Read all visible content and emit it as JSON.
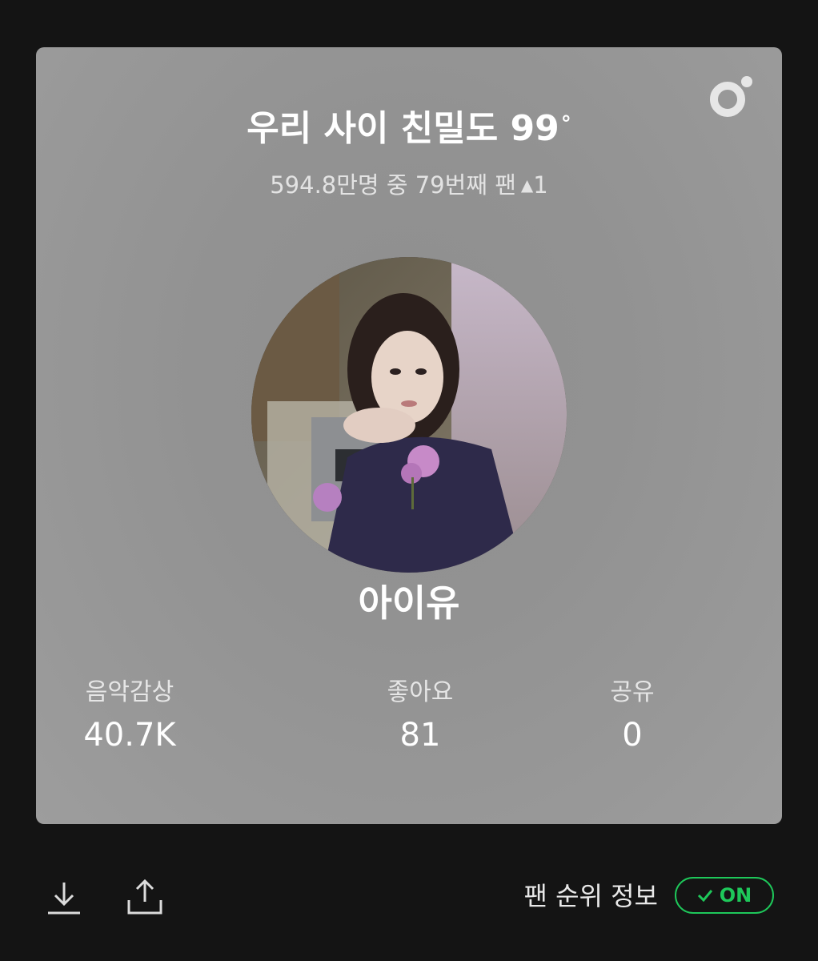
{
  "card": {
    "title": "우리 사이 친밀도 99",
    "title_degree": "°",
    "subtitle": "594.8만명 중 79번째 팬",
    "rank_change_arrow": "▲",
    "rank_change_value": "1",
    "logo_icon": "melon-logo-icon",
    "avatar_icon": "artist-photo",
    "artist_name": "아이유",
    "stats": [
      {
        "label": "음악감상",
        "value": "40.7K"
      },
      {
        "label": "좋아요",
        "value": "81"
      },
      {
        "label": "공유",
        "value": "0"
      }
    ]
  },
  "bottom_bar": {
    "download_icon": "download-icon",
    "share_icon": "share-icon",
    "rank_info_label": "팬 순위 정보",
    "toggle_state": "ON",
    "toggle_icon": "check-icon"
  },
  "colors": {
    "background": "#141414",
    "card": "#969696",
    "accent_green": "#1ec85a",
    "text_white": "#ffffff"
  }
}
